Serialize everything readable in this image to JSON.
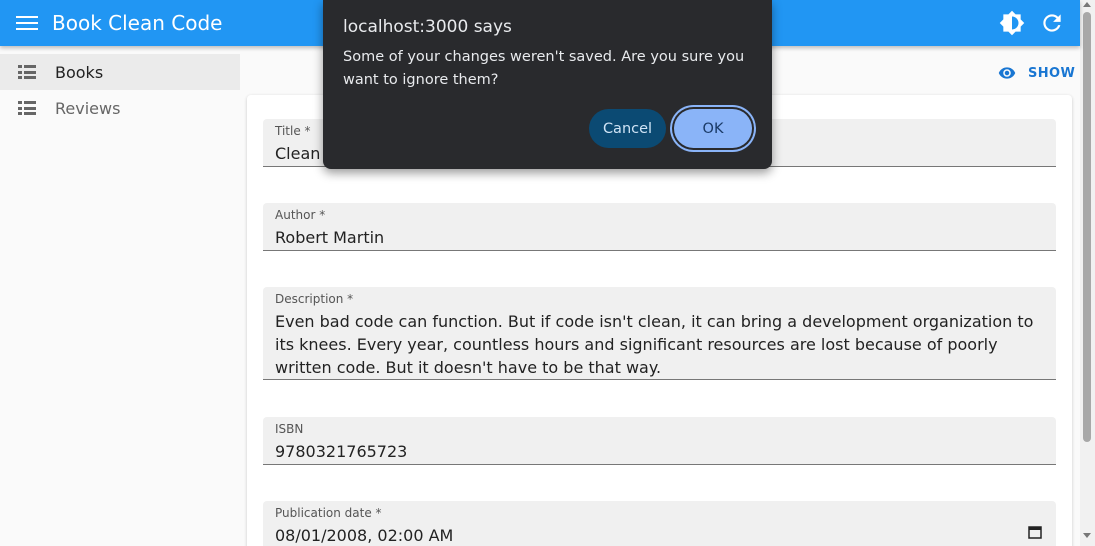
{
  "appbar": {
    "title": "Book Clean Code",
    "menu_icon": "menu-icon",
    "theme_icon": "brightness-icon",
    "refresh_icon": "refresh-icon",
    "color": "#2196f3"
  },
  "sidebar": {
    "items": [
      {
        "label": "Books",
        "icon": "list-icon",
        "active": true
      },
      {
        "label": "Reviews",
        "icon": "list-icon",
        "active": false
      }
    ]
  },
  "actions": {
    "show_label": "SHOW",
    "show_icon": "eye-icon"
  },
  "form": {
    "title": {
      "label": "Title *",
      "value": "Clean Code"
    },
    "author": {
      "label": "Author *",
      "value": "Robert Martin"
    },
    "description": {
      "label": "Description *",
      "value": "Even bad code can function. But if code isn't clean, it can bring a development organization to its knees. Every year, countless hours and significant resources are lost because of poorly written code. But it doesn't have to be that way."
    },
    "isbn": {
      "label": "ISBN",
      "value": "9780321765723"
    },
    "publication_date": {
      "label": "Publication date *",
      "value": "08/01/2008, 02:00 AM"
    }
  },
  "dialog": {
    "title": "localhost:3000 says",
    "message": "Some of your changes weren't saved. Are you sure you want to ignore them?",
    "cancel_label": "Cancel",
    "ok_label": "OK"
  }
}
